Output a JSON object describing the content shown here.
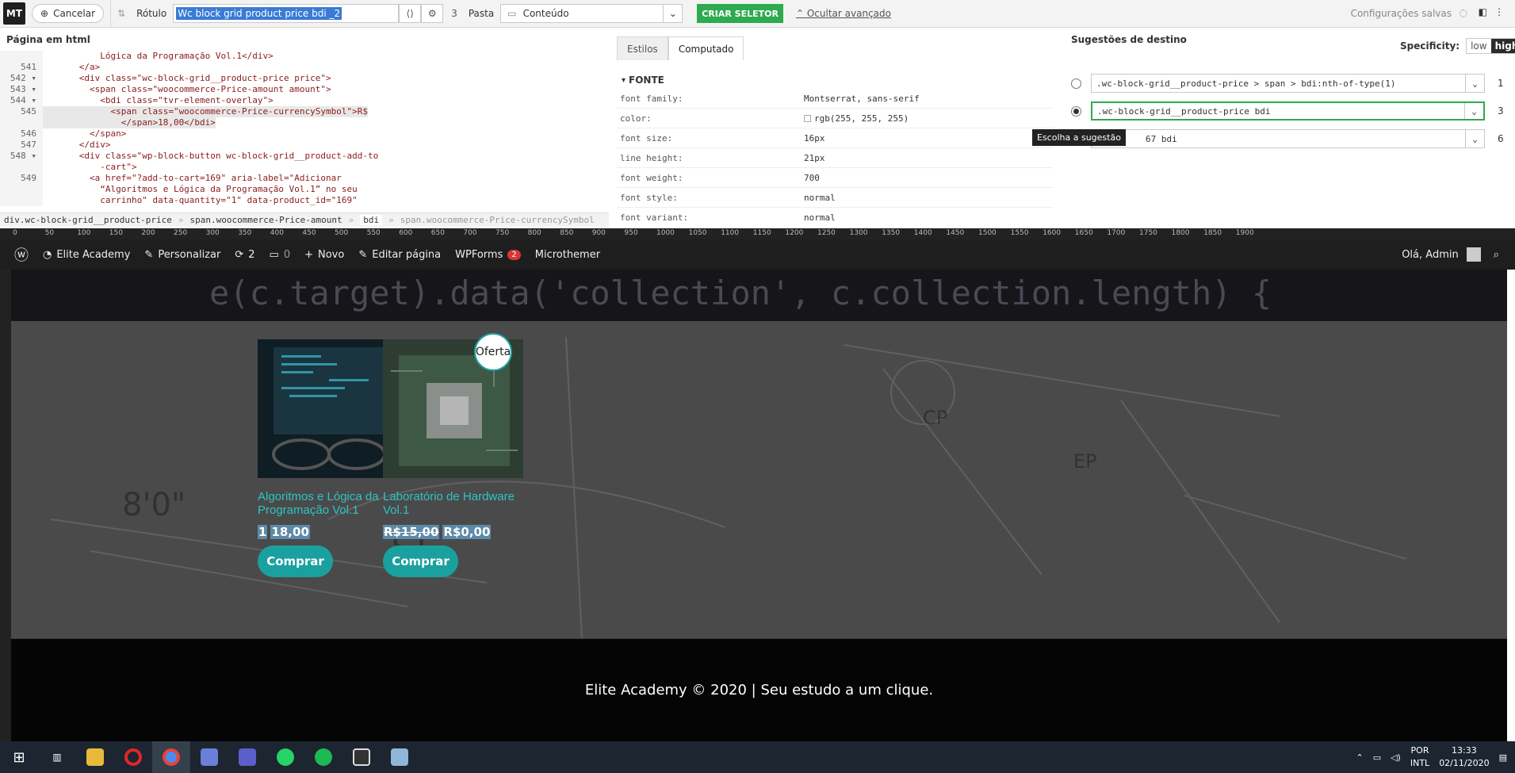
{
  "toolbar": {
    "logo": "MT",
    "cancel_label": "Cancelar",
    "rotulo_label": "Rótulo",
    "rotulo_value": "Wc block grid product price bdi _2",
    "count": "3",
    "pasta_label": "Pasta",
    "pasta_value": "Conteúdo",
    "criar_label": "CRIAR SELETOR",
    "ocultar_label": "Ocultar avançado",
    "config_saved": "Configurações salvas"
  },
  "html_panel": {
    "title": "Página em html",
    "lines": [
      {
        "n": "",
        "t": "          Lógica da Programação Vol.1</div>"
      },
      {
        "n": "541",
        "t": "      </a>"
      },
      {
        "n": "542 ▾",
        "t": "      <div class=\"wc-block-grid__product-price price\">"
      },
      {
        "n": "543 ▾",
        "t": "        <span class=\"woocommerce-Price-amount amount\">"
      },
      {
        "n": "544 ▾",
        "t": "          <bdi class=\"tvr-element-overlay\">"
      },
      {
        "n": "545",
        "t": "            <span class=\"woocommerce-Price-currencySymbol\">R$"
      },
      {
        "n": "",
        "t": "              </span>18,00</bdi>"
      },
      {
        "n": "546",
        "t": "        </span>"
      },
      {
        "n": "547",
        "t": "      </div>"
      },
      {
        "n": "548 ▾",
        "t": "      <div class=\"wp-block-button wc-block-grid__product-add-to"
      },
      {
        "n": "",
        "t": "          -cart\">"
      },
      {
        "n": "549",
        "t": "        <a href=\"?add-to-cart=169\" aria-label=\"Adicionar"
      },
      {
        "n": "",
        "t": "          “Algoritmos e Lógica da Programação Vol.1” no seu"
      },
      {
        "n": "",
        "t": "          carrinho\" data-quantity=\"1\" data-product_id=\"169\""
      }
    ],
    "breadcrumb": [
      "div.wc-block-grid__product-price",
      "span.woocommerce-Price-amount",
      "bdi",
      "span.woocommerce-Price-currencySymbol"
    ]
  },
  "styles_panel": {
    "tab_styles": "Estilos",
    "tab_computed": "Computado",
    "section": "FONTE",
    "props": [
      {
        "k": "font family:",
        "v": "Montserrat, sans-serif"
      },
      {
        "k": "color:",
        "v": "rgb(255, 255, 255)"
      },
      {
        "k": "font size:",
        "v": "16px"
      },
      {
        "k": "line height:",
        "v": "21px"
      },
      {
        "k": "font weight:",
        "v": "700"
      },
      {
        "k": "font style:",
        "v": "normal"
      },
      {
        "k": "font variant:",
        "v": "normal"
      }
    ]
  },
  "suggestions": {
    "title": "Sugestões de destino",
    "specificity_label": "Specificity:",
    "low": "low",
    "high": "high",
    "items": [
      {
        "selector": ".wc-block-grid__product-price > span > bdi:nth-of-type(1)",
        "num": "1"
      },
      {
        "selector": ".wc-block-grid__product-price bdi",
        "num": "3"
      },
      {
        "selector": "67 bdi",
        "num": "6"
      }
    ],
    "tooltip": "Escolha a sugestão"
  },
  "ruler": [
    "0",
    "50",
    "100",
    "150",
    "200",
    "250",
    "300",
    "350",
    "400",
    "450",
    "500",
    "550",
    "600",
    "650",
    "700",
    "750",
    "800",
    "850",
    "900",
    "950",
    "1000",
    "1050",
    "1100",
    "1150",
    "1200",
    "1250",
    "1300",
    "1350",
    "1400",
    "1450",
    "1500",
    "1550",
    "1600",
    "1650",
    "1700",
    "1750",
    "1800",
    "1850",
    "1900"
  ],
  "wpbar": {
    "site": "Elite Academy",
    "customize": "Personalizar",
    "updates": "2",
    "comments": "0",
    "new": "Novo",
    "edit": "Editar página",
    "wpforms": "WPForms",
    "wpforms_badge": "2",
    "microthemer": "Microthemer",
    "greeting": "Olá, Admin"
  },
  "site": {
    "hero_code": "e(c.target).data('collection', c.collection.length) {",
    "products": [
      {
        "title": "Algoritmos e Lógica da Programação Vol.1",
        "price": "18,00",
        "currency": "1",
        "button": "Comprar"
      },
      {
        "title": "Laboratório de Hardware Vol.1",
        "old_price": "R$15,00",
        "price": "R$0,00",
        "button": "Comprar",
        "badge": "Oferta"
      }
    ],
    "footer": "Elite Academy © 2020 | Seu estudo a um clique."
  },
  "taskbar": {
    "lang1": "POR",
    "lang2": "INTL",
    "time": "13:33",
    "date": "02/11/2020"
  }
}
